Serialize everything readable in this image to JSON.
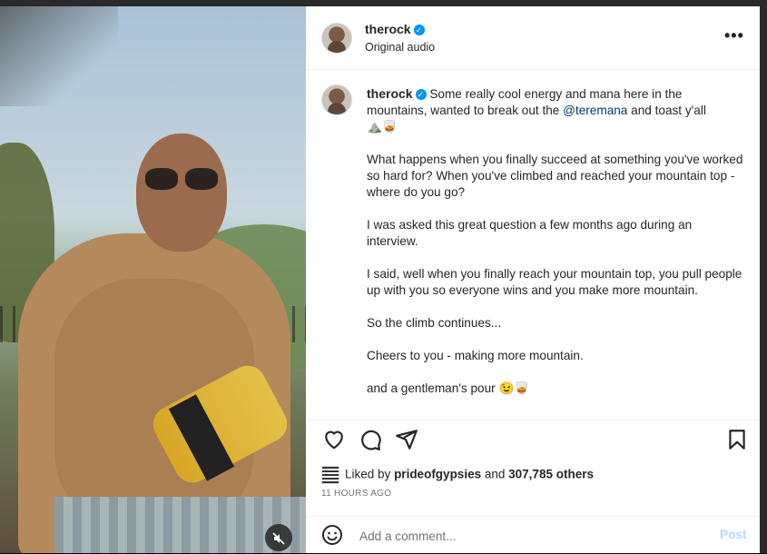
{
  "header": {
    "username": "therock",
    "subtitle": "Original audio",
    "more_icon": "more-horizontal-icon"
  },
  "caption": {
    "username": "therock",
    "first_text": "Some really cool energy and mana here in the mountains, wanted to break out the",
    "mention": "@teremana",
    "first_text_end": "and toast y'all",
    "first_emoji": "⛰️🥃",
    "paragraphs": [
      "What happens when you finally succeed at something you've worked so hard for? When you've climbed and reached your mountain top - where do you go?",
      "I was asked this great question a few months ago during an interview.",
      "I said, well when you finally reach your mountain top, you pull people up with you so everyone wins and you make more mountain.",
      "So the climb continues...",
      "Cheers to you - making more mountain."
    ],
    "last_text": "and a gentleman's pour",
    "last_emoji": "😉🥃"
  },
  "likes": {
    "prefix": "Liked by",
    "user": "prideofgypsies",
    "joiner": "and",
    "others": "307,785 others"
  },
  "timestamp": "11 HOURS AGO",
  "comment": {
    "placeholder": "Add a comment...",
    "post_label": "Post"
  },
  "colors": {
    "verified": "#0095f6",
    "mention": "#00376b",
    "post_disabled": "#b3dbff"
  }
}
